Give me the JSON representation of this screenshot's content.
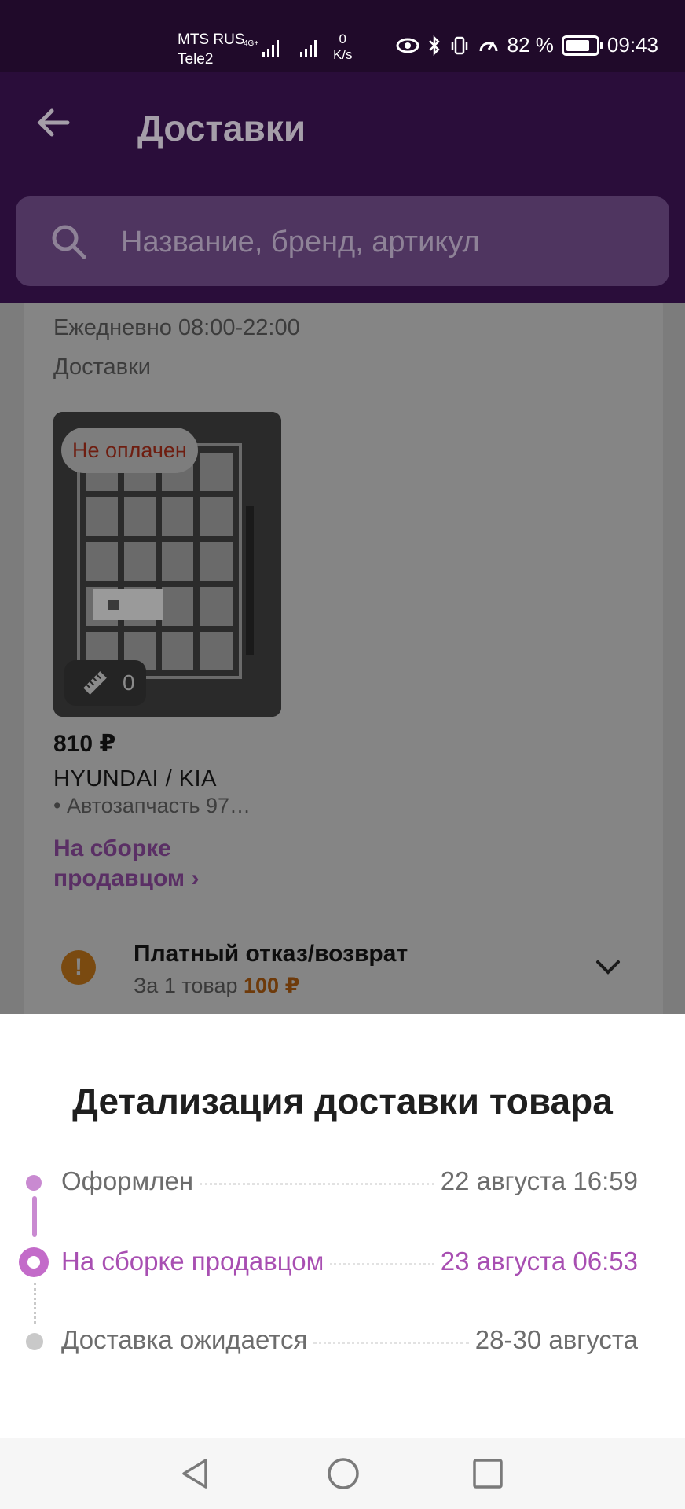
{
  "status_bar": {
    "carrier1": "MTS RUS",
    "carrier2": "Tele2",
    "net_tag": "4G+",
    "net_speed_value": "0",
    "net_speed_unit": "K/s",
    "battery_percent": "82 %",
    "battery_level": 0.82,
    "time": "09:43"
  },
  "header": {
    "title": "Доставки",
    "search_placeholder": "Название, бренд, артикул"
  },
  "delivery": {
    "hours": "Ежедневно 08:00-22:00",
    "section_label": "Доставки",
    "item": {
      "payment_badge": "Не оплачен",
      "measure_count": "0",
      "price": "810 ₽",
      "brand": "HYUNDAI / KIA",
      "name": "• Автозапчасть 97…",
      "status_link": "На сборке продавцом ›"
    },
    "refund": {
      "title": "Платный отказ/возврат",
      "subtitle_prefix": "За 1 товар",
      "amount": "100 ₽"
    }
  },
  "sheet": {
    "title": "Детализация доставки товара",
    "timeline": [
      {
        "label": "Оформлен",
        "date": "22 августа 16:59",
        "state": "done"
      },
      {
        "label": "На сборке продавцом",
        "date": "23 августа 06:53",
        "state": "current"
      },
      {
        "label": "Доставка ожидается",
        "date": "28-30 августа",
        "state": "pending"
      }
    ]
  },
  "colors": {
    "accent": "#a84fb2",
    "header_bg": "#2a0d3a",
    "warning": "#e0861a"
  }
}
